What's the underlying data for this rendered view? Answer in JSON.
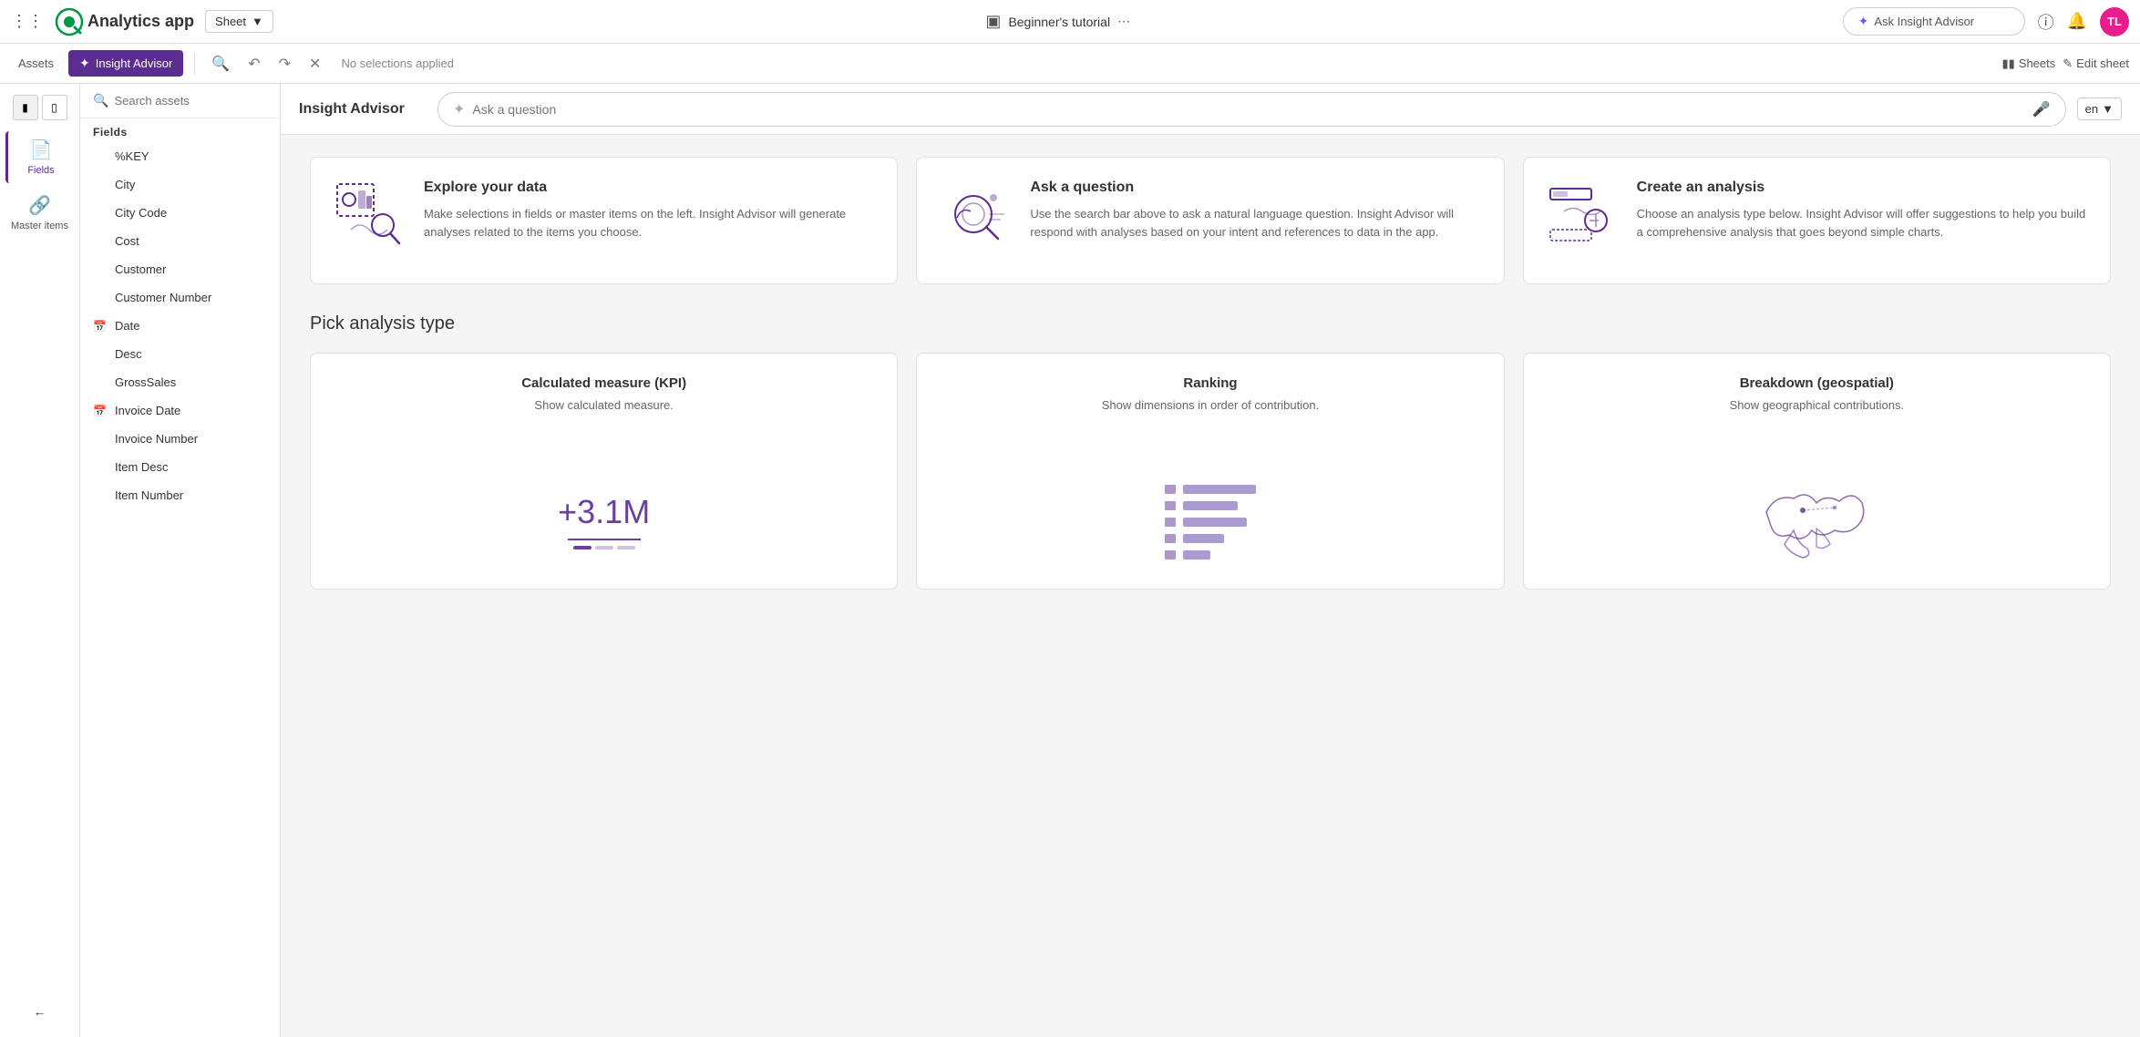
{
  "topNav": {
    "appTitle": "Analytics app",
    "sheetDropdown": "Sheet",
    "tutorialLabel": "Beginner's tutorial",
    "askInsightPlaceholder": "Ask Insight Advisor",
    "avatarInitials": "TL"
  },
  "toolbar": {
    "assetsLabel": "Assets",
    "insightAdvisorLabel": "Insight Advisor",
    "noSelectionsLabel": "No selections applied",
    "sheetsLabel": "Sheets",
    "editSheetLabel": "Edit sheet"
  },
  "sideNav": {
    "fieldsLabel": "Fields",
    "masterItemsLabel": "Master items"
  },
  "fieldsPanel": {
    "panelTitle": "Fields",
    "searchPlaceholder": "Search assets",
    "sectionLabel": "Fields",
    "fields": [
      {
        "name": "%KEY",
        "hasIcon": false
      },
      {
        "name": "City",
        "hasIcon": false
      },
      {
        "name": "City Code",
        "hasIcon": false
      },
      {
        "name": "Cost",
        "hasIcon": false
      },
      {
        "name": "Customer",
        "hasIcon": false
      },
      {
        "name": "Customer Number",
        "hasIcon": false
      },
      {
        "name": "Date",
        "hasIcon": true
      },
      {
        "name": "Desc",
        "hasIcon": false
      },
      {
        "name": "GrossSales",
        "hasIcon": false
      },
      {
        "name": "Invoice Date",
        "hasIcon": true
      },
      {
        "name": "Invoice Number",
        "hasIcon": false
      },
      {
        "name": "Item Desc",
        "hasIcon": false
      },
      {
        "name": "Item Number",
        "hasIcon": false
      }
    ]
  },
  "insightAdvisor": {
    "title": "Insight Advisor",
    "askPlaceholder": "Ask a question",
    "langCode": "en",
    "cards": [
      {
        "title": "Explore your data",
        "description": "Make selections in fields or master items on the left. Insight Advisor will generate analyses related to the items you choose."
      },
      {
        "title": "Ask a question",
        "description": "Use the search bar above to ask a natural language question. Insight Advisor will respond with analyses based on your intent and references to data in the app."
      },
      {
        "title": "Create an analysis",
        "description": "Choose an analysis type below. Insight Advisor will offer suggestions to help you build a comprehensive analysis that goes beyond simple charts."
      }
    ],
    "pickAnalysisTitle": "Pick analysis type",
    "analysisTypes": [
      {
        "title": "Calculated measure (KPI)",
        "description": "Show calculated measure.",
        "kpiValue": "+3.1M"
      },
      {
        "title": "Ranking",
        "description": "Show dimensions in order of contribution."
      },
      {
        "title": "Breakdown (geospatial)",
        "description": "Show geographical contributions."
      }
    ]
  }
}
